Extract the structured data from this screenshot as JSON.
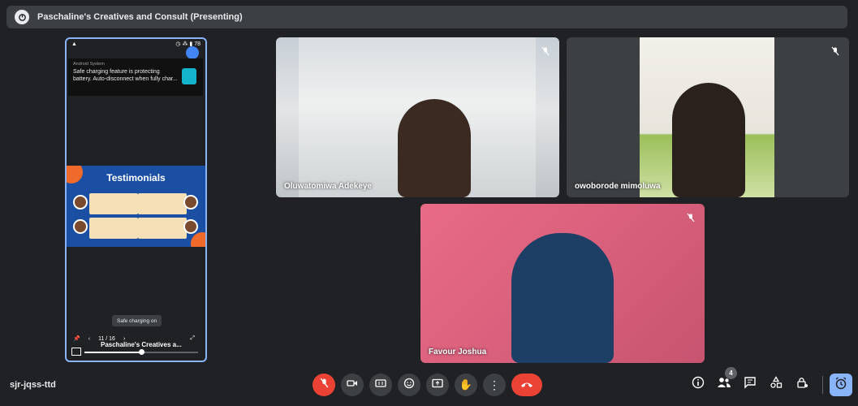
{
  "header": {
    "title": "Paschaline's Creatives and Consult (Presenting)",
    "icon": "presentation-icon"
  },
  "presentation": {
    "notification": {
      "app": "Android System",
      "message": "Safe charging feature is protecting battery. Auto-disconnect when fully char..."
    },
    "slide": {
      "heading": "Testimonials"
    },
    "toast": "Safe charging on",
    "page_indicator": "11 / 16",
    "footer_title": "Paschaline's Creatives a...",
    "progress_fraction": 0.5
  },
  "participants": [
    {
      "name": "Oluwatomiwa Adekeye",
      "muted": true
    },
    {
      "name": "owoborode mimoluwa",
      "muted": true
    },
    {
      "name": "Favour Joshua",
      "muted": true
    }
  ],
  "footer": {
    "meeting_code": "sjr-jqss-ttd",
    "people_count": "4"
  },
  "colors": {
    "accent": "#8ab4f8",
    "danger": "#ea4335",
    "bg": "#202124",
    "surface": "#3c4043"
  }
}
